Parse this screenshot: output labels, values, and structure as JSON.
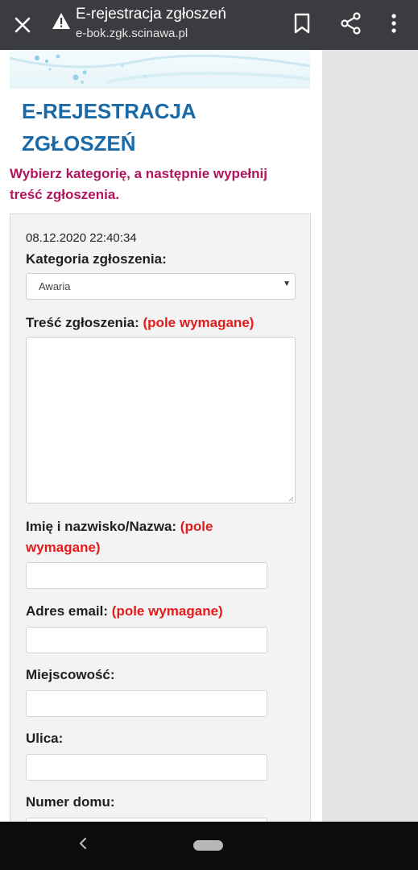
{
  "browser": {
    "title": "E-rejestracja zgłoszeń",
    "url": "e-bok.zgk.scinawa.pl",
    "icons": [
      "close-icon",
      "warning-icon",
      "bookmark-icon",
      "share-icon",
      "more-vert-icon"
    ]
  },
  "page": {
    "heading": "E-REJESTRACJA ZGŁOSZEŃ",
    "intro": "Wybierz kategorię, a następnie wypełnij treść zgłoszenia.",
    "colors": {
      "heading": "#1a6aa8",
      "intro": "#b0155d",
      "required": "#e21b1b"
    }
  },
  "form": {
    "timestamp": "08.12.2020 22:40:34",
    "category_label": "Kategoria zgłoszenia:",
    "category_value": "Awaria",
    "content_label": "Treść zgłoszenia:",
    "name_label": "Imię i nazwisko/Nazwa:",
    "email_label": "Adres email:",
    "required_note": "(pole wymagane)",
    "city_label": "Miejscowość:",
    "street_label": "Ulica:",
    "house_label": "Numer domu:",
    "content_value": "",
    "name_value": "",
    "email_value": "",
    "city_value": "",
    "street_value": "",
    "house_value": ""
  },
  "system_nav": {
    "icons": [
      "back-icon",
      "home-pill"
    ]
  }
}
